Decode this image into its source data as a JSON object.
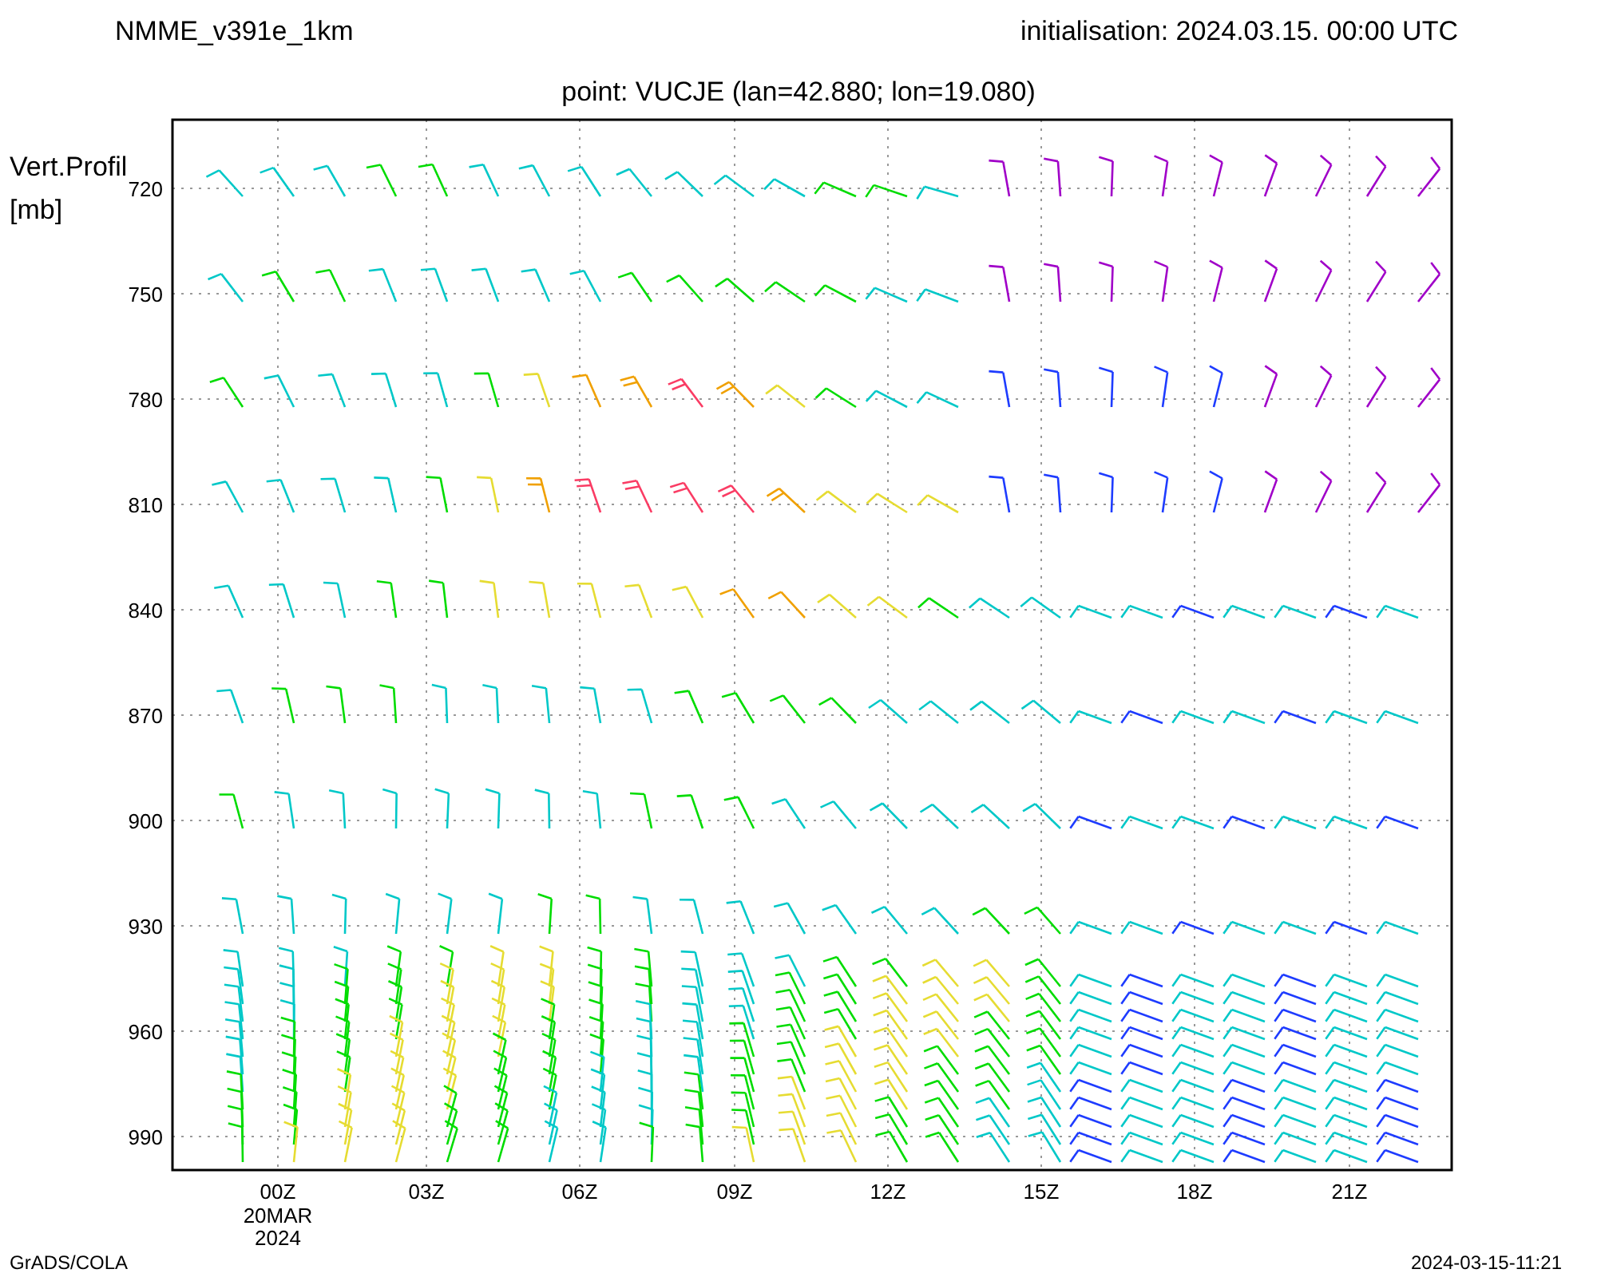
{
  "header": {
    "model": "NMME_v391e_1km",
    "init": "initialisation: 2024.03.15. 00:00 UTC",
    "point": "point: VUCJE (lan=42.880; lon=19.080)"
  },
  "y_axis": {
    "label_lines": [
      "Vert.Profil",
      "[mb]"
    ],
    "ticks": [
      "720",
      "750",
      "780",
      "810",
      "840",
      "870",
      "900",
      "930",
      "960",
      "990"
    ]
  },
  "x_axis": {
    "ticks": [
      {
        "label": "00Z",
        "date": [
          "20MAR",
          "2024"
        ]
      },
      {
        "label": "03Z"
      },
      {
        "label": "06Z"
      },
      {
        "label": "09Z"
      },
      {
        "label": "12Z"
      },
      {
        "label": "15Z"
      },
      {
        "label": "18Z"
      },
      {
        "label": "21Z"
      }
    ]
  },
  "footer": {
    "left": "GrADS/COLA",
    "right": "2024-03-15-11:21"
  }
}
